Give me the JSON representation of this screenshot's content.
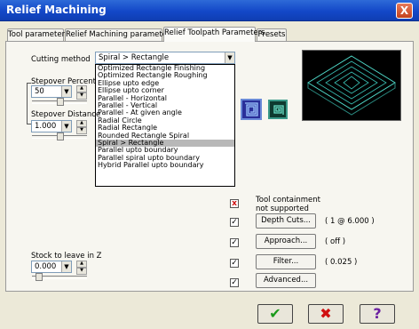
{
  "window": {
    "title": "Relief Machining",
    "close_label": "X"
  },
  "tabs": [
    {
      "label": "Tool parameters"
    },
    {
      "label": "Relief Machining parameters"
    },
    {
      "label": "Relief Toolpath Parameters"
    },
    {
      "label": "Presets"
    }
  ],
  "cutting_method": {
    "label": "Cutting method",
    "value": "Spiral > Rectangle",
    "options": [
      "Optimized Rectangle Finishing",
      "Optimized Rectangle Roughing",
      "Ellipse upto edge",
      "Ellipse upto corner",
      "Parallel - Horizontal",
      "Parallel - Vertical",
      "Parallel - At given angle",
      "Radial Circle",
      "Radial Rectangle",
      "Rounded Rectangle Spiral",
      "Spiral > Rectangle",
      "Parallel upto boundary",
      "Parallel spiral upto boundary",
      "Hybrid Parallel upto boundary"
    ],
    "selected_index": 10
  },
  "stepover_percent": {
    "label": "Stepover Percent",
    "value": "50"
  },
  "stepover_distance": {
    "label": "Stepover Distance",
    "value": "1.000"
  },
  "stock_to_leave": {
    "label": "Stock to leave in Z",
    "value": "0.000"
  },
  "tool_containment": {
    "label_line1": "Tool containment",
    "label_line2": "not supported",
    "mark": "x"
  },
  "options": [
    {
      "button": "Depth Cuts...",
      "info": "( 1 @ 6.000 )",
      "mark": "✓"
    },
    {
      "button": "Approach...",
      "info": "( off )",
      "mark": "✓"
    },
    {
      "button": "Filter...",
      "info": "( 0.025 )",
      "mark": "✓"
    },
    {
      "button": "Advanced...",
      "info": "",
      "mark": "✓"
    }
  ],
  "footer": {
    "ok": "✔",
    "cancel": "✖",
    "help": "?"
  },
  "colors": {
    "title_bar": "#1348c8",
    "ok_icon": "#1a9a1a",
    "cancel_icon": "#d01010",
    "help_icon": "#6a1fa0",
    "preview_bg": "#000000",
    "preview_lines": "#3ad0c0"
  }
}
